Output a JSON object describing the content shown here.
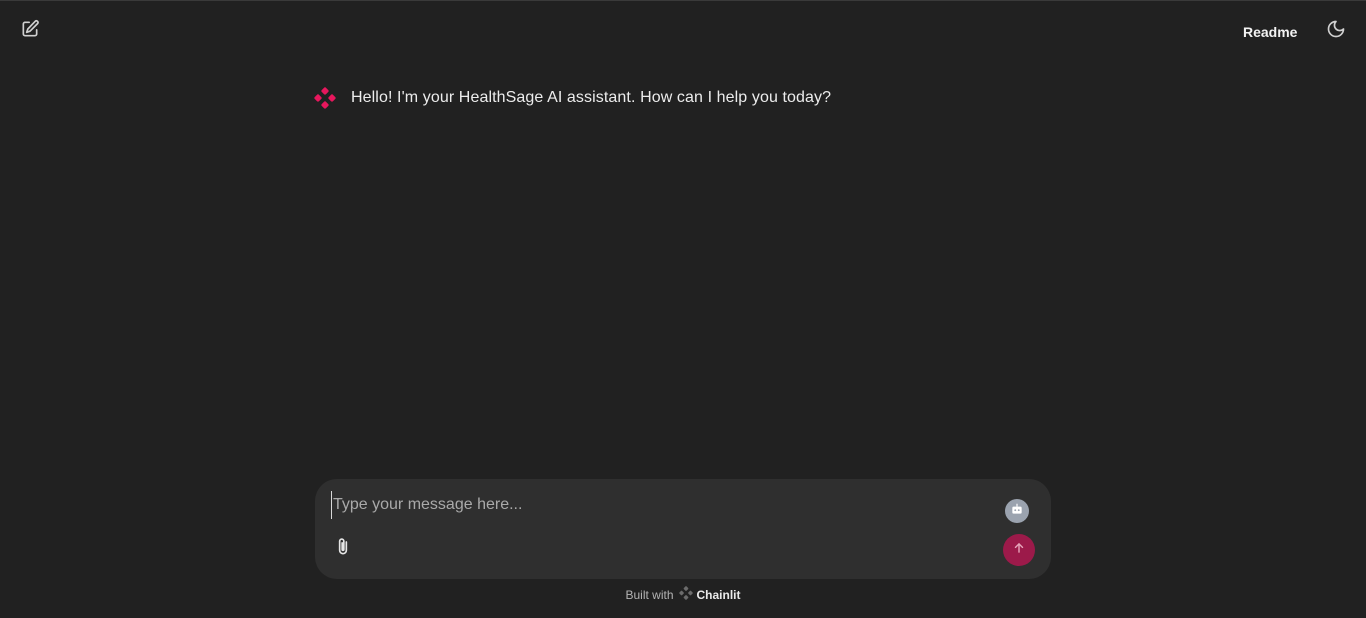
{
  "header": {
    "new_chat_icon": "edit-icon",
    "readme_label": "Readme",
    "theme_icon": "moon-icon"
  },
  "messages": [
    {
      "author_icon": "assistant-logo-icon",
      "text": "Hello! I'm your HealthSage AI assistant. How can I help you today?"
    }
  ],
  "composer": {
    "placeholder": "Type your message here...",
    "value": "",
    "settings_icon": "robot-icon",
    "attach_icon": "paperclip-icon",
    "send_icon": "arrow-up-icon"
  },
  "footer": {
    "built_with": "Built with",
    "brand": "Chainlit"
  },
  "colors": {
    "background": "#212121",
    "composer": "#2f2f2f",
    "send_button": "#9c1a4a",
    "logo": "#e8175d"
  }
}
